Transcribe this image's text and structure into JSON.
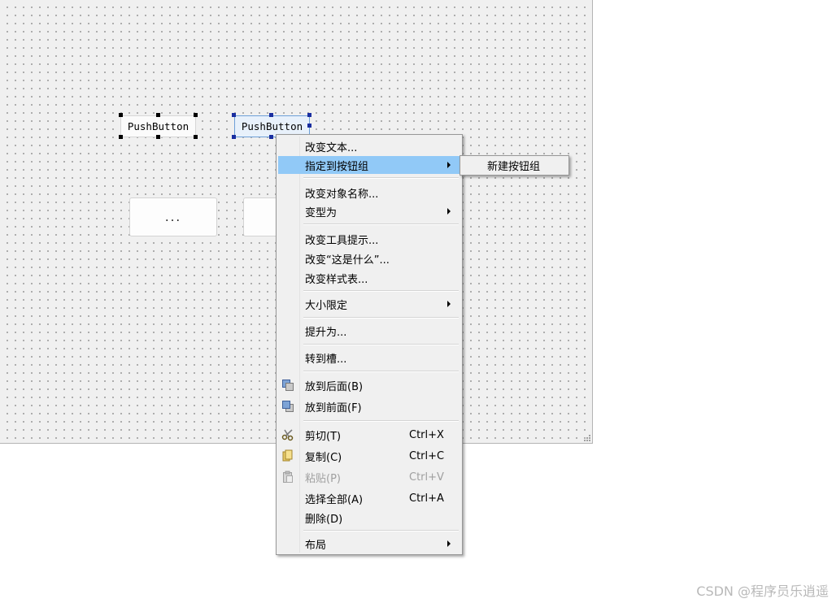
{
  "form": {
    "buttons": [
      {
        "label": "PushButton"
      },
      {
        "label": "PushButton"
      }
    ],
    "tool_buttons": [
      {
        "label": "..."
      }
    ]
  },
  "context_menu": {
    "items": {
      "change_text": "改变文本...",
      "assign_group": "指定到按钮组",
      "change_object_name": "改变对象名称...",
      "morph_into": "变型为",
      "change_tooltip": "改变工具提示...",
      "change_whats_this": "改变“这是什么”...",
      "change_stylesheet": "改变样式表...",
      "size_constraints": "大小限定",
      "promote_to": "提升为...",
      "go_to_slot": "转到槽...",
      "send_to_back": "放到后面(B)",
      "bring_to_front": "放到前面(F)",
      "cut": "剪切(T)",
      "cut_shortcut": "Ctrl+X",
      "copy": "复制(C)",
      "copy_shortcut": "Ctrl+C",
      "paste": "粘贴(P)",
      "paste_shortcut": "Ctrl+V",
      "select_all": "选择全部(A)",
      "select_all_shortcut": "Ctrl+A",
      "delete": "删除(D)",
      "layout": "布局"
    }
  },
  "sub_menu": {
    "new_button_group": "新建按钮组"
  },
  "watermark": "CSDN @程序员乐逍遥",
  "colors": {
    "highlight": "#91c9f7",
    "menu_bg": "#f0f0f0",
    "canvas_bg": "#f0f0f0",
    "disabled_text": "#a0a0a0"
  },
  "icons": [
    "send-to-back-icon",
    "bring-to-front-icon",
    "scissors-icon",
    "copy-icon",
    "paste-icon",
    "submenu-arrow-icon"
  ]
}
